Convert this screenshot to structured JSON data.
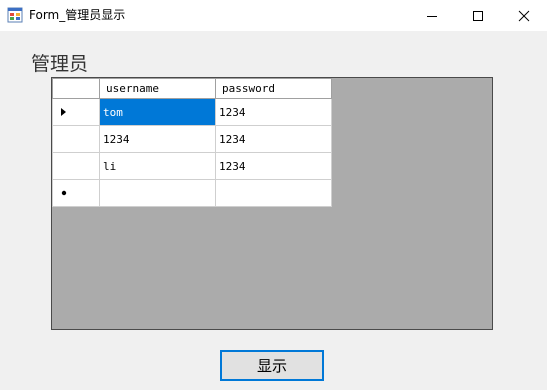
{
  "window": {
    "title": "Form_管理员显示",
    "icon": "winforms-form-icon",
    "controls": {
      "minimize_icon": "minimize-icon",
      "maximize_icon": "maximize-icon",
      "close_icon": "close-icon"
    }
  },
  "label": {
    "text": "管理员"
  },
  "grid": {
    "columns": [
      "username",
      "password"
    ],
    "rows": [
      {
        "indicator": "current-row-arrow-icon",
        "username": "tom",
        "password": "1234",
        "selected_cell": "username"
      },
      {
        "indicator": "",
        "username": "1234",
        "password": "1234"
      },
      {
        "indicator": "",
        "username": "li",
        "password": "1234"
      },
      {
        "indicator": "new-row-asterisk-icon",
        "username": "",
        "password": ""
      }
    ],
    "colors": {
      "background": "#ababab",
      "selection": "#0078d7",
      "selection_text": "#ffffff",
      "cell": "#ffffff"
    }
  },
  "button": {
    "label": "显示",
    "focus_color": "#0078d7"
  }
}
